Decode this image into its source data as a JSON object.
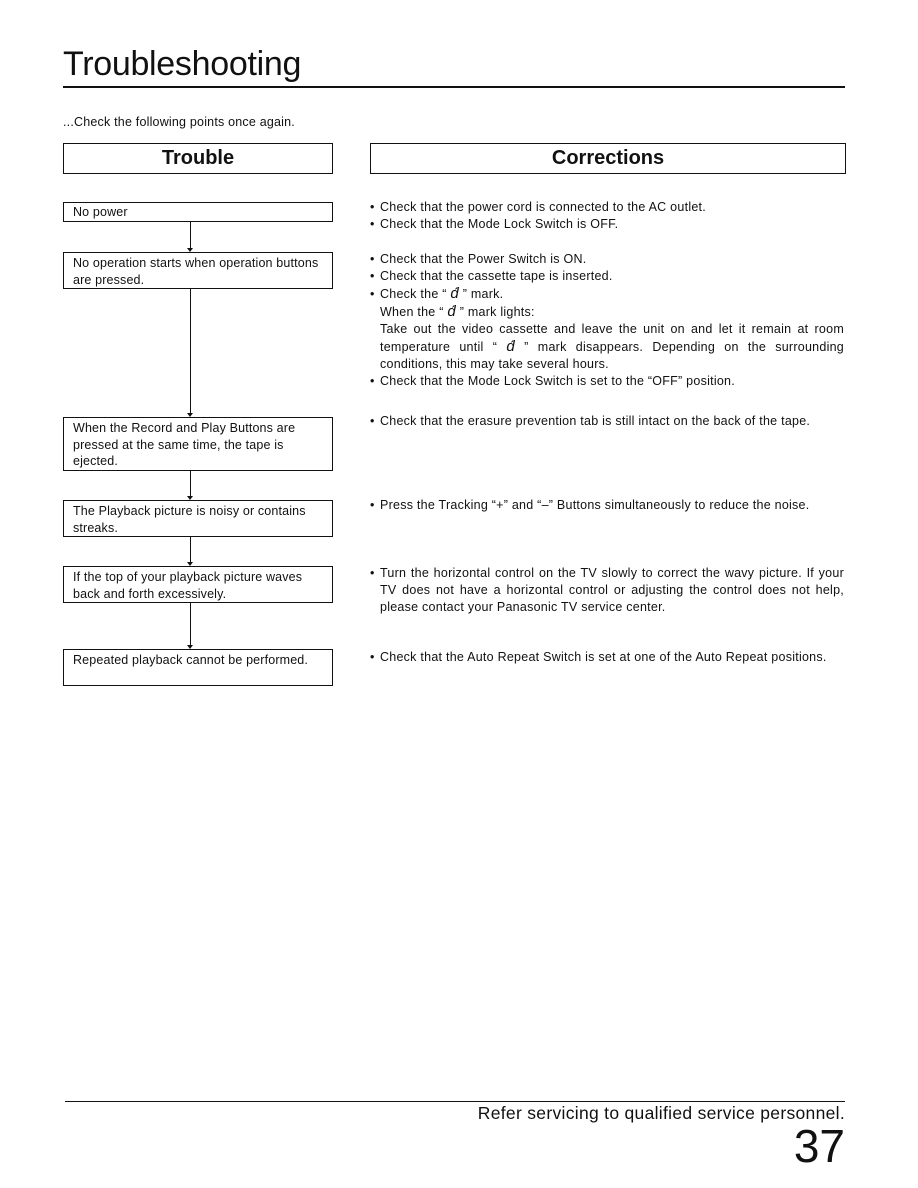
{
  "page": {
    "title": "Troubleshooting",
    "intro": "...Check the following points once again.",
    "footer_note": "Refer servicing to qualified service personnel.",
    "page_number": "37"
  },
  "headers": {
    "trouble": "Trouble",
    "corrections": "Corrections"
  },
  "troubles": [
    {
      "text": "No power"
    },
    {
      "text": "No operation starts when operation buttons are pressed."
    },
    {
      "text": "When the Record and Play Buttons are pressed at the same time, the tape is ejected."
    },
    {
      "text": "The Playback picture is noisy or contains streaks."
    },
    {
      "text": "If the top of your playback picture waves back and forth excessively."
    },
    {
      "text": "Repeated playback cannot be performed."
    }
  ],
  "corrections": {
    "no_power": [
      "Check that the power cord is connected to the AC outlet.",
      "Check that the Mode Lock Switch is OFF."
    ],
    "no_operation": {
      "b1": "Check that the Power Switch is ON.",
      "b2": "Check that the cassette tape is inserted.",
      "b3_pre": "Check the “ ",
      "b3_post": " ” mark.",
      "when_pre": "When the “ ",
      "when_post": " ” mark lights:",
      "take_out_pre": "Take out the video cassette and leave the unit on and let it remain at room temperature until “ ",
      "take_out_post": " ” mark disappears. Depending on the surrounding conditions, this may take several hours.",
      "b4": "Check that the Mode Lock Switch is set to the “OFF” position.",
      "dew_mark": "d́"
    },
    "tape_ejected": "Check that the erasure prevention tab is still intact on the back of the tape.",
    "noisy": "Press the Tracking “+” and “–” Buttons simultaneously to reduce the noise.",
    "waves": "Turn the horizontal control on the TV slowly to correct the wavy picture. If your TV does not have a horizontal control or adjusting the control does not help, please contact your Panasonic TV service center.",
    "repeat": "Check that the Auto Repeat Switch is set at one of the Auto Repeat positions."
  },
  "bullet_char": "•"
}
